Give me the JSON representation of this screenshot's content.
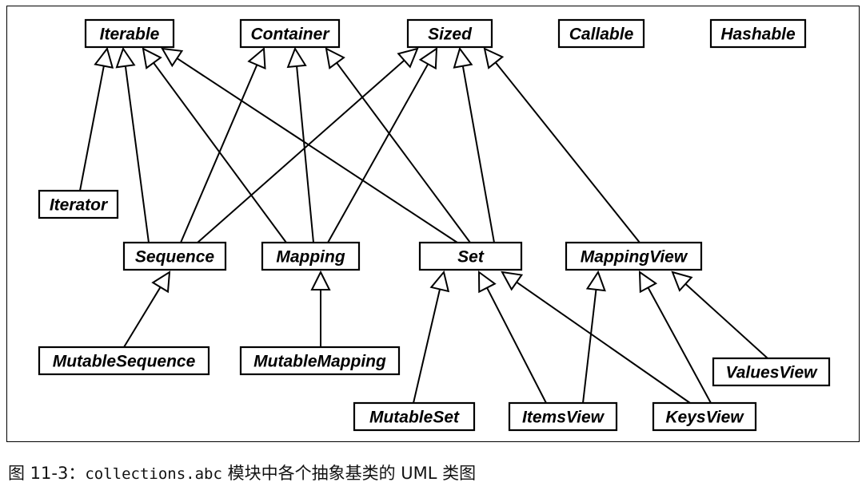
{
  "diagram": {
    "classes": [
      {
        "id": "Iterable",
        "label": "Iterable"
      },
      {
        "id": "Container",
        "label": "Container"
      },
      {
        "id": "Sized",
        "label": "Sized"
      },
      {
        "id": "Callable",
        "label": "Callable"
      },
      {
        "id": "Hashable",
        "label": "Hashable"
      },
      {
        "id": "Iterator",
        "label": "Iterator"
      },
      {
        "id": "Sequence",
        "label": "Sequence"
      },
      {
        "id": "Mapping",
        "label": "Mapping"
      },
      {
        "id": "Set",
        "label": "Set"
      },
      {
        "id": "MappingView",
        "label": "MappingView"
      },
      {
        "id": "MutableSequence",
        "label": "MutableSequence"
      },
      {
        "id": "MutableMapping",
        "label": "MutableMapping"
      },
      {
        "id": "ValuesView",
        "label": "ValuesView"
      },
      {
        "id": "MutableSet",
        "label": "MutableSet"
      },
      {
        "id": "ItemsView",
        "label": "ItemsView"
      },
      {
        "id": "KeysView",
        "label": "KeysView"
      }
    ],
    "inheritance": [
      {
        "child": "Iterator",
        "parent": "Iterable"
      },
      {
        "child": "Sequence",
        "parent": "Iterable"
      },
      {
        "child": "Mapping",
        "parent": "Iterable"
      },
      {
        "child": "Set",
        "parent": "Iterable"
      },
      {
        "child": "Sequence",
        "parent": "Container"
      },
      {
        "child": "Mapping",
        "parent": "Container"
      },
      {
        "child": "Set",
        "parent": "Container"
      },
      {
        "child": "Sequence",
        "parent": "Sized"
      },
      {
        "child": "Mapping",
        "parent": "Sized"
      },
      {
        "child": "Set",
        "parent": "Sized"
      },
      {
        "child": "MappingView",
        "parent": "Sized"
      },
      {
        "child": "MutableSequence",
        "parent": "Sequence"
      },
      {
        "child": "MutableMapping",
        "parent": "Mapping"
      },
      {
        "child": "MutableSet",
        "parent": "Set"
      },
      {
        "child": "ItemsView",
        "parent": "Set"
      },
      {
        "child": "KeysView",
        "parent": "Set"
      },
      {
        "child": "ItemsView",
        "parent": "MappingView"
      },
      {
        "child": "KeysView",
        "parent": "MappingView"
      },
      {
        "child": "ValuesView",
        "parent": "MappingView"
      }
    ]
  },
  "caption": {
    "prefix": "图 11-3：",
    "code": "collections.abc",
    "suffix": " 模块中各个抽象基类的 UML 类图"
  }
}
